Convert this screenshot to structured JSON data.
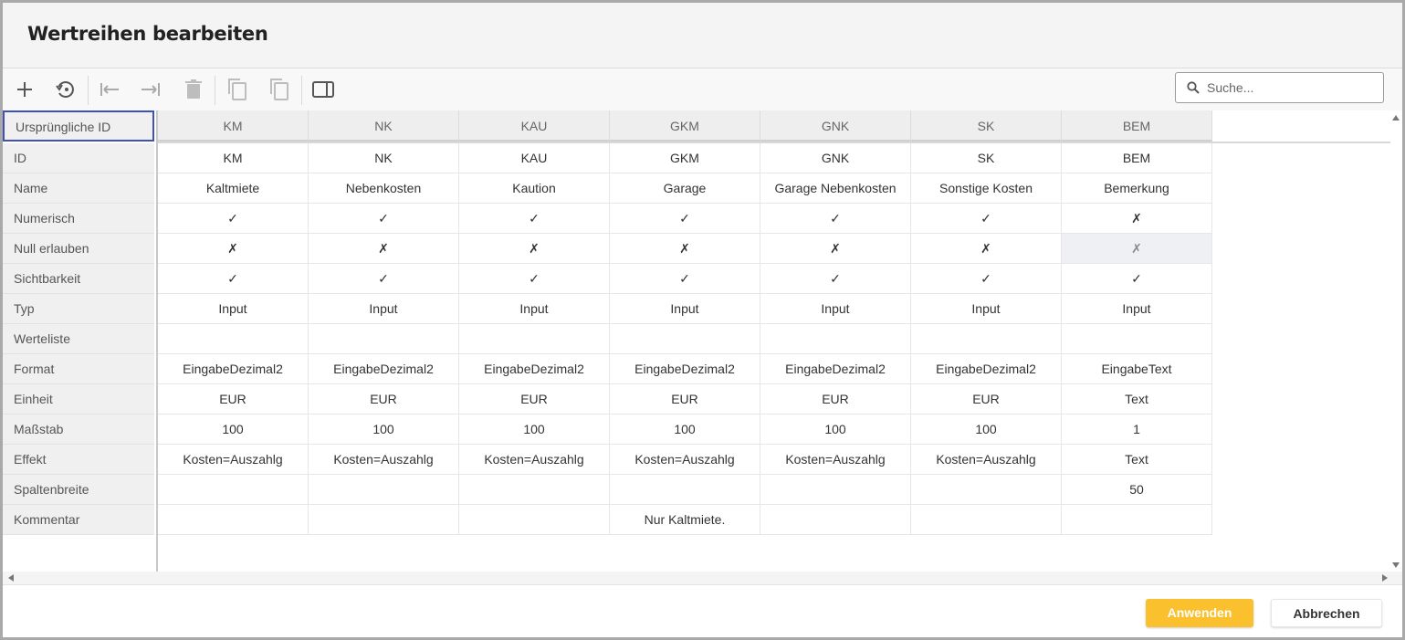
{
  "dialog": {
    "title": "Wertreihen bearbeiten"
  },
  "toolbar": {
    "icons": [
      "add-icon",
      "restore-icon",
      "move-left-icon",
      "move-right-icon",
      "delete-icon",
      "copy-icon",
      "copy-alt-icon",
      "panel-icon"
    ],
    "search_placeholder": "Suche..."
  },
  "grid": {
    "corner_label": "Ursprüngliche ID",
    "columns": [
      "KM",
      "NK",
      "KAU",
      "GKM",
      "GNK",
      "SK",
      "BEM"
    ],
    "row_labels": [
      "ID",
      "Name",
      "Numerisch",
      "Null erlauben",
      "Sichtbarkeit",
      "Typ",
      "Werteliste",
      "Format",
      "Einheit",
      "Maßstab",
      "Effekt",
      "Spaltenbreite",
      "Kommentar"
    ],
    "rows": [
      [
        "KM",
        "NK",
        "KAU",
        "GKM",
        "GNK",
        "SK",
        "BEM"
      ],
      [
        "Kaltmiete",
        "Nebenkosten",
        "Kaution",
        "Garage",
        "Garage Nebenkosten",
        "Sonstige Kosten",
        "Bemerkung"
      ],
      [
        "✓",
        "✓",
        "✓",
        "✓",
        "✓",
        "✓",
        "✗"
      ],
      [
        "✗",
        "✗",
        "✗",
        "✗",
        "✗",
        "✗",
        "✗"
      ],
      [
        "✓",
        "✓",
        "✓",
        "✓",
        "✓",
        "✓",
        "✓"
      ],
      [
        "Input",
        "Input",
        "Input",
        "Input",
        "Input",
        "Input",
        "Input"
      ],
      [
        "",
        "",
        "",
        "",
        "",
        "",
        ""
      ],
      [
        "EingabeDezimal2",
        "EingabeDezimal2",
        "EingabeDezimal2",
        "EingabeDezimal2",
        "EingabeDezimal2",
        "EingabeDezimal2",
        "EingabeText"
      ],
      [
        "EUR",
        "EUR",
        "EUR",
        "EUR",
        "EUR",
        "EUR",
        "Text"
      ],
      [
        "100",
        "100",
        "100",
        "100",
        "100",
        "100",
        "1"
      ],
      [
        "Kosten=Auszahlg",
        "Kosten=Auszahlg",
        "Kosten=Auszahlg",
        "Kosten=Auszahlg",
        "Kosten=Auszahlg",
        "Kosten=Auszahlg",
        "Text"
      ],
      [
        "",
        "",
        "",
        "",
        "",
        "",
        "50"
      ],
      [
        "",
        "",
        "",
        "Nur Kaltmiete.",
        "",
        "",
        ""
      ]
    ]
  },
  "footer": {
    "apply_label": "Anwenden",
    "cancel_label": "Abbrechen"
  },
  "colors": {
    "accent": "#fbc02d",
    "selection": "#3f51b5"
  }
}
